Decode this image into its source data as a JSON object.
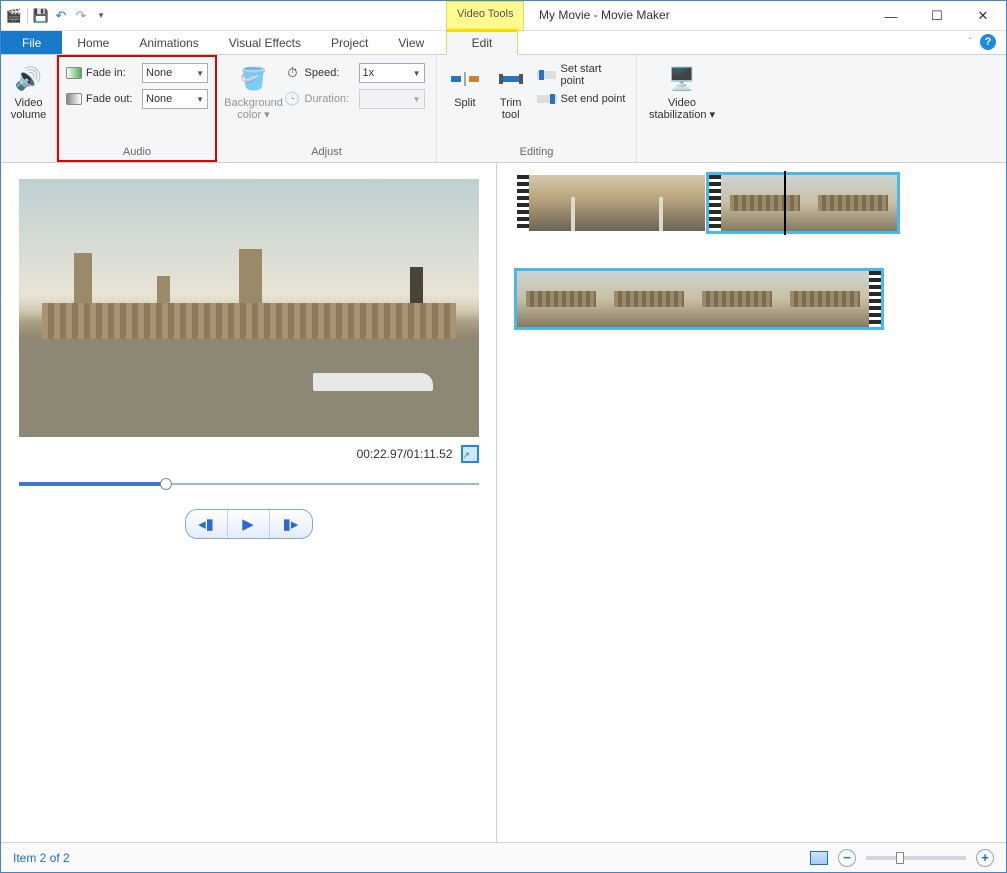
{
  "window": {
    "title": "My Movie - Movie Maker",
    "contextual_tab_header": "Video Tools"
  },
  "qat": {
    "undo": "↶",
    "redo": "↷"
  },
  "tabs": {
    "file": "File",
    "home": "Home",
    "animations": "Animations",
    "visual_effects": "Visual Effects",
    "project": "Project",
    "view": "View",
    "edit": "Edit"
  },
  "ribbon": {
    "video_volume": "Video volume",
    "audio": {
      "group_label": "Audio",
      "fade_in_label": "Fade in:",
      "fade_in_value": "None",
      "fade_out_label": "Fade out:",
      "fade_out_value": "None"
    },
    "background_color": "Background color",
    "adjust": {
      "group_label": "Adjust",
      "speed_label": "Speed:",
      "speed_value": "1x",
      "duration_label": "Duration:",
      "duration_value": ""
    },
    "split": "Split",
    "trim_tool": "Trim tool",
    "set_start": "Set start point",
    "set_end": "Set end point",
    "editing_label": "Editing",
    "video_stabilization": "Video stabilization"
  },
  "preview": {
    "time_display": "00:22.97/01:11.52"
  },
  "status": {
    "item_text": "Item 2 of 2"
  }
}
